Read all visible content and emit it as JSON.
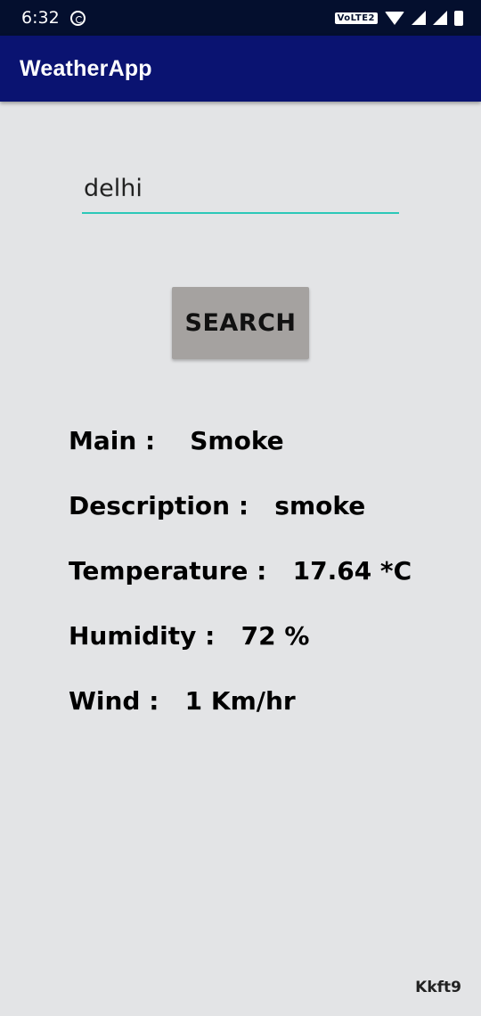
{
  "status_bar": {
    "time": "6:32",
    "network_badge": "VoLTE2",
    "icons": [
      "notification-icon",
      "wifi-icon",
      "signal-icon",
      "signal-roaming-icon",
      "battery-icon"
    ]
  },
  "app_bar": {
    "title": "WeatherApp"
  },
  "search": {
    "city_value": "delhi",
    "button_label": "SEARCH"
  },
  "weather": {
    "main_label": "Main :",
    "main_value": "Smoke",
    "description_label": "Description :",
    "description_value": "smoke",
    "temperature_label": "Temperature :",
    "temperature_value": "17.64 *C",
    "humidity_label": "Humidity :",
    "humidity_value": "72 %",
    "wind_label": "Wind :",
    "wind_value": "1 Km/hr"
  },
  "footer": {
    "tag": "Kkft9"
  },
  "colors": {
    "status_bar": "#040f2e",
    "app_bar": "#0a1371",
    "background": "#e3e4e6",
    "input_underline": "#2cc8b8",
    "button": "#a5a2a0"
  }
}
